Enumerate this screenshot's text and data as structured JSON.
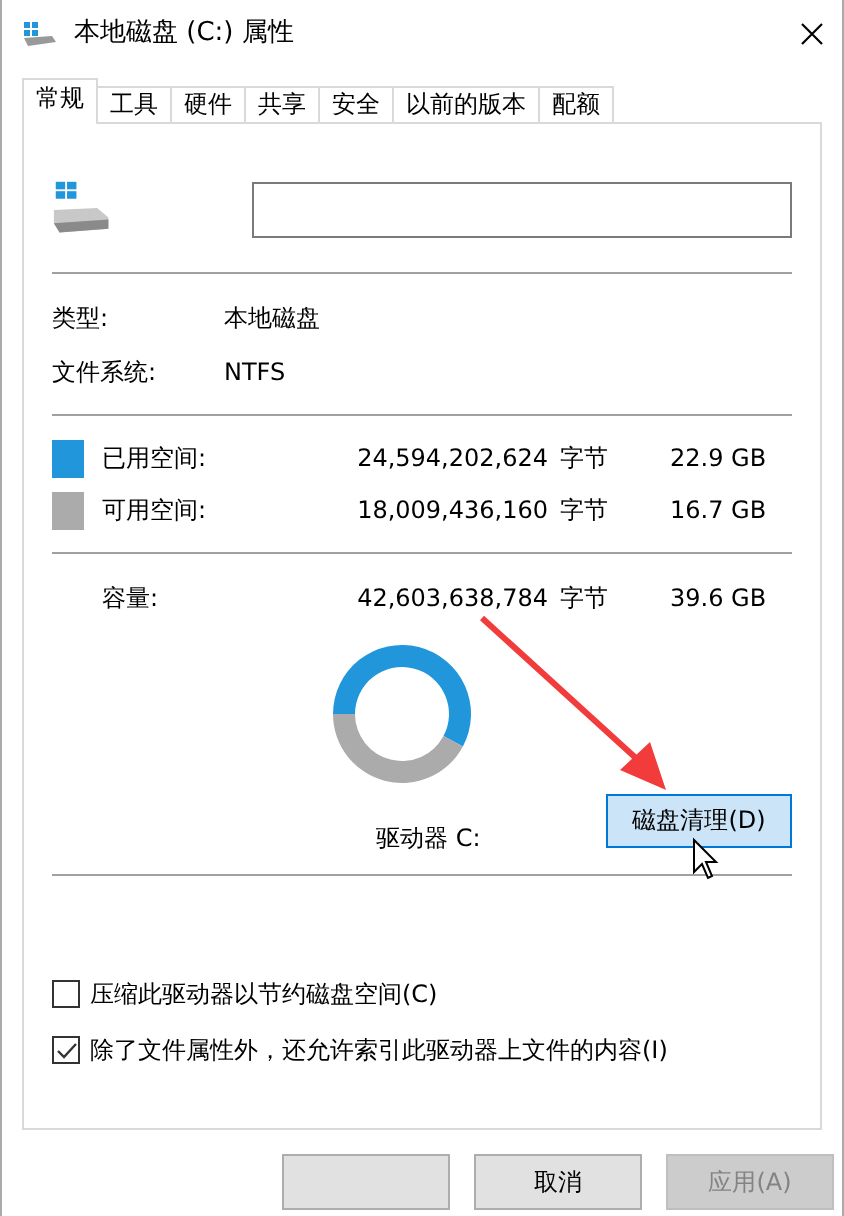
{
  "window": {
    "title": "本地磁盘 (C:) 属性"
  },
  "tabs": [
    {
      "label": "常规",
      "selected": true
    },
    {
      "label": "工具",
      "selected": false
    },
    {
      "label": "硬件",
      "selected": false
    },
    {
      "label": "共享",
      "selected": false
    },
    {
      "label": "安全",
      "selected": false
    },
    {
      "label": "以前的版本",
      "selected": false
    },
    {
      "label": "配额",
      "selected": false
    }
  ],
  "info": [
    {
      "label": "类型:",
      "value": "本地磁盘"
    },
    {
      "label": "文件系统:",
      "value": "NTFS"
    }
  ],
  "space": [
    {
      "label": "已用空间:",
      "bytes": "24,594,202,624",
      "unit": "字节",
      "size": "22.9 GB",
      "color": "#2196db"
    },
    {
      "label": "可用空间:",
      "bytes": "18,009,436,160",
      "unit": "字节",
      "size": "16.7 GB",
      "color": "#ababab"
    }
  ],
  "capacity": {
    "label": "容量:",
    "bytes": "42,603,638,784",
    "unit": "字节",
    "size": "39.6 GB"
  },
  "drive_usage": {
    "chart_data": {
      "type": "donut",
      "values": [
        57.8,
        42.2
      ]
    }
  },
  "drive_label": "驱动器 C:",
  "cleanup_button": {
    "label": "磁盘清理(D)",
    "focused": true
  },
  "options": [
    {
      "label": "压缩此驱动器以节约磁盘空间(C)",
      "checked": false
    },
    {
      "label": "除了文件属性外，还允许索引此驱动器上文件的内容(I)",
      "checked": true
    }
  ],
  "buttons": [
    {
      "disabled": false
    },
    {
      "label": "取消",
      "disabled": false
    },
    {
      "label": "应用(A)",
      "disabled": true
    }
  ]
}
